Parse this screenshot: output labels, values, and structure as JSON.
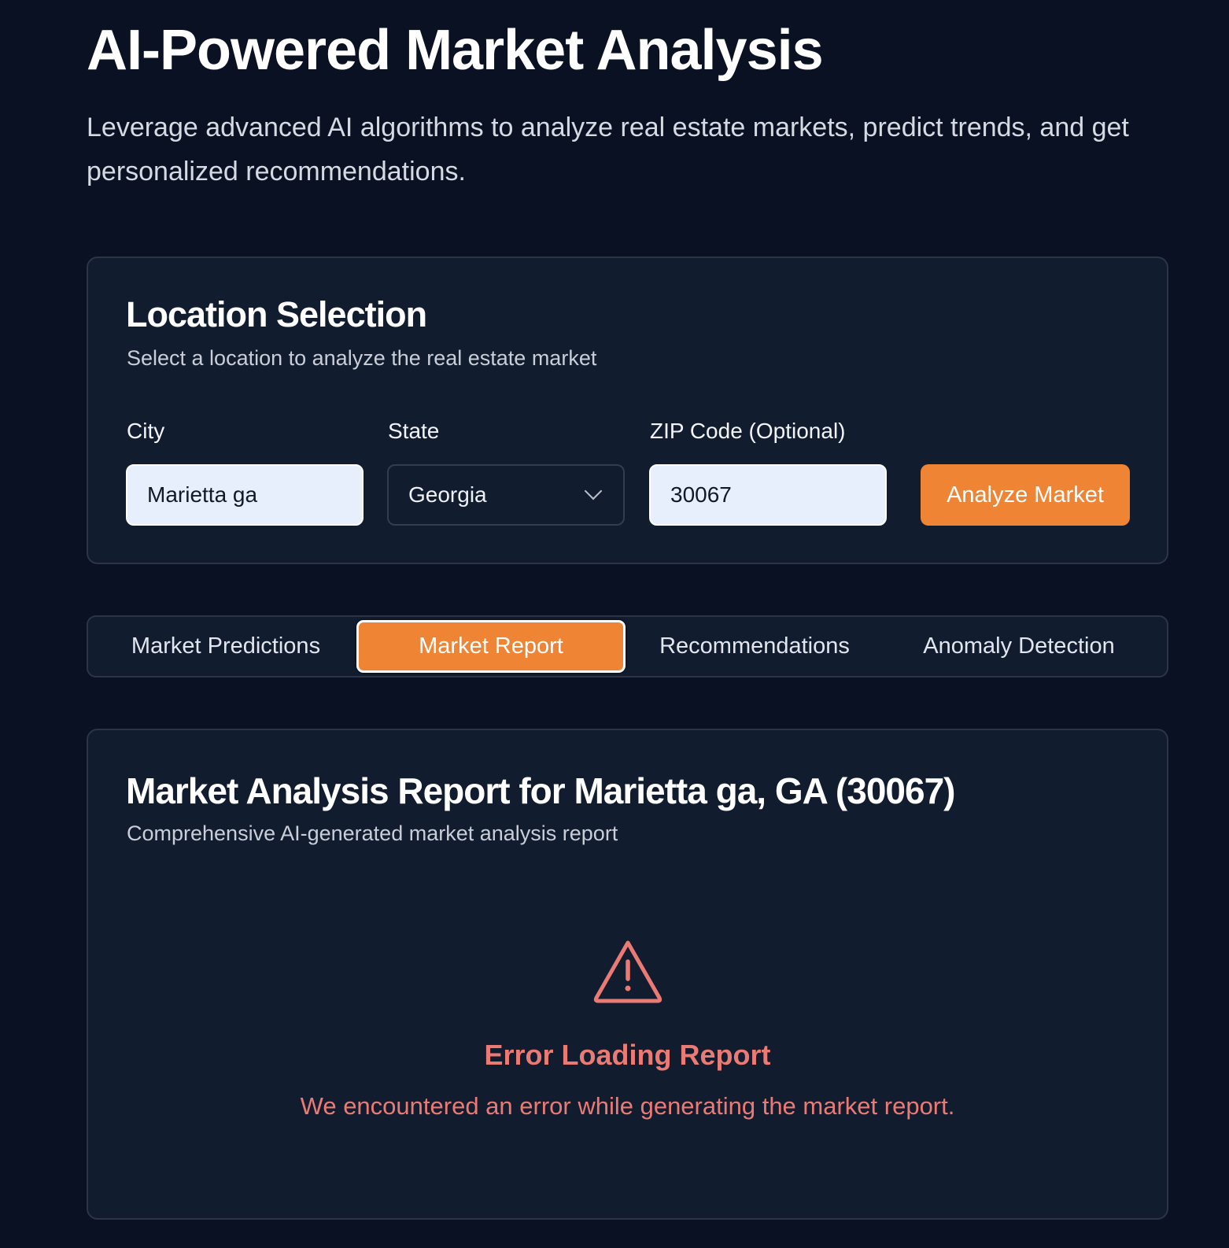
{
  "header": {
    "title": "AI-Powered Market Analysis",
    "subtitle": "Leverage advanced AI algorithms to analyze real estate markets, predict trends, and get personalized recommendations."
  },
  "location": {
    "title": "Location Selection",
    "description": "Select a location to analyze the real estate market",
    "city_label": "City",
    "city_value": "Marietta ga",
    "state_label": "State",
    "state_value": "Georgia",
    "zip_label": "ZIP Code (Optional)",
    "zip_value": "30067",
    "analyze_label": "Analyze Market"
  },
  "tabs": [
    {
      "label": "Market Predictions",
      "active": false
    },
    {
      "label": "Market Report",
      "active": true
    },
    {
      "label": "Recommendations",
      "active": false
    },
    {
      "label": "Anomaly Detection",
      "active": false
    }
  ],
  "report": {
    "title": "Market Analysis Report for Marietta ga, GA (30067)",
    "description": "Comprehensive AI-generated market analysis report",
    "error_icon": "warning-triangle-icon",
    "error_title": "Error Loading Report",
    "error_message": "We encountered an error while generating the market report."
  },
  "colors": {
    "background": "#0a1122",
    "card": "#121c2f",
    "accent": "#ee8434",
    "error": "#ea7b74",
    "input_light": "#e8effc"
  }
}
